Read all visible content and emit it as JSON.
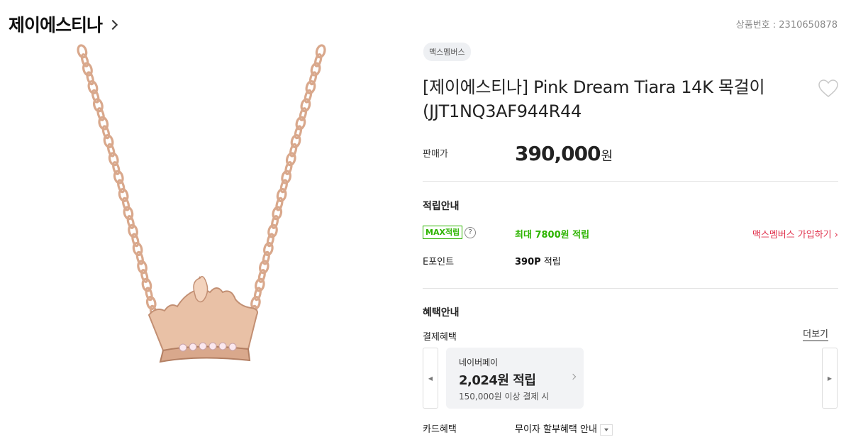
{
  "brand": {
    "name": "제이에스티나"
  },
  "product": {
    "number_label": "상품번호 : 2310650878",
    "badge": "맥스멤버스",
    "title": "[제이에스티나] Pink Dream Tiara 14K 목걸이 (JJT1NQ3AF944R44"
  },
  "price": {
    "label": "판매가",
    "value": "390,000",
    "unit": "원"
  },
  "points": {
    "section_title": "적립안내",
    "max_label": "MAX적립",
    "help_icon": "?",
    "max_value": "최대 7800원 적립",
    "join_link": "맥스멤버스 가입하기",
    "epoint_label": "E포인트",
    "epoint_amount": "390P",
    "epoint_suffix": "적립"
  },
  "benefits": {
    "section_title": "혜택안내",
    "payment_label": "결제혜택",
    "more_link": "더보기",
    "card": {
      "name": "네이버페이",
      "value": "2,024원 적립",
      "condition": "150,000원 이상 결제 시"
    },
    "card_label": "카드혜택",
    "card_value": "무이자 할부혜택 안내"
  },
  "colors": {
    "accent_green": "#2db400",
    "link_red": "#e0314c",
    "chain_gold": "#d4a58a"
  }
}
